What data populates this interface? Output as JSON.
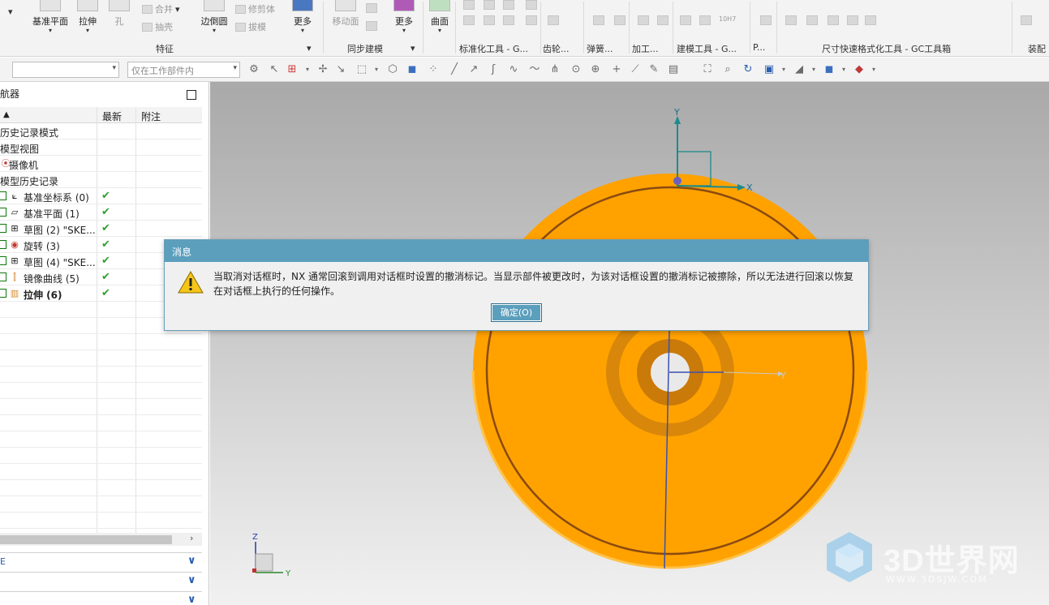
{
  "ribbon": {
    "buttons": [
      {
        "id": "datum-plane",
        "label": "基准平面"
      },
      {
        "id": "extrude",
        "label": "拉伸"
      },
      {
        "id": "hole",
        "label": "孔"
      },
      {
        "id": "edge-blend",
        "label": "边倒圆"
      },
      {
        "id": "more-feature",
        "label": "更多"
      },
      {
        "id": "move-face",
        "label": "移动面"
      },
      {
        "id": "more-sync",
        "label": "更多"
      },
      {
        "id": "surface",
        "label": "曲面"
      },
      {
        "id": "assembly",
        "label": "装配"
      }
    ],
    "small": {
      "unite": "合并",
      "shell": "抽壳",
      "trim": "修剪体",
      "draft": "拔模",
      "tolerance": "10H7"
    },
    "groups": {
      "feature": "特征",
      "sync": "同步建模",
      "std_tools": "标准化工具 - G...",
      "gear": "齿轮...",
      "spring": "弹簧...",
      "machining": "加工...",
      "modeling_tools": "建模工具 - G...",
      "p": "P...",
      "dimension": "尺寸快速格式化工具 - GC工具箱"
    }
  },
  "toolbar": {
    "filter_value": "",
    "scope_value": "仅在工作部件内"
  },
  "navigator": {
    "title": "航器",
    "columns": {
      "name": "",
      "latest": "最新",
      "note": "附注"
    },
    "items": [
      {
        "label": "历史记录模式",
        "latest": ""
      },
      {
        "label": "模型视图",
        "latest": ""
      },
      {
        "label": "摄像机",
        "latest": ""
      },
      {
        "label": "模型历史记录",
        "latest": ""
      },
      {
        "label": "基准坐标系 (0)",
        "latest": "✔"
      },
      {
        "label": "基准平面 (1)",
        "latest": "✔"
      },
      {
        "label": "草图 (2) \"SKE...",
        "latest": "✔"
      },
      {
        "label": "旋转 (3)",
        "latest": "✔"
      },
      {
        "label": "草图 (4) \"SKE...",
        "latest": "✔"
      },
      {
        "label": "镜像曲线 (5)",
        "latest": "✔"
      },
      {
        "label": "拉伸 (6)",
        "latest": "✔"
      }
    ],
    "panel_bar_1": "E"
  },
  "viewport": {
    "axis_x": "X",
    "axis_y": "Y",
    "axis_y2": "Y",
    "triad_z": "Z",
    "triad_y": "Y"
  },
  "dialog": {
    "title": "消息",
    "message": "当取消对话框时，NX 通常回滚到调用对话框时设置的撤消标记。当显示部件被更改时，为该对话框设置的撤消标记被擦除，所以无法进行回滚以恢复在对话框上执行的任何操作。",
    "ok_label": "确定(O)"
  },
  "watermark": {
    "title": "3D世界网",
    "url": "WWW.3DSJW.COM"
  },
  "colors": {
    "part": "#ffa500",
    "dialog_title": "#5b9fbd",
    "check": "#2ea12e"
  }
}
